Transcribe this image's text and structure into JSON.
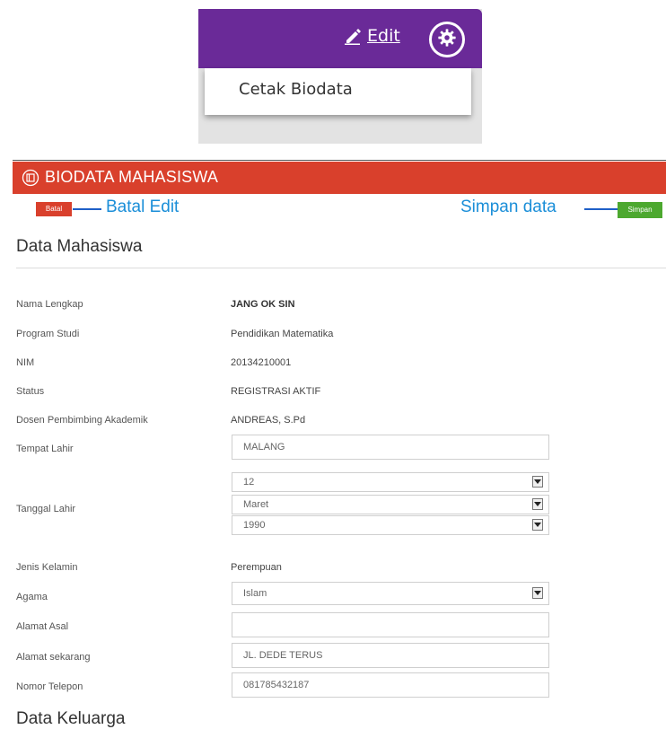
{
  "topbar": {
    "edit_label": "Edit",
    "dropdown_item": "Cetak Biodata"
  },
  "panel": {
    "title": "BIODATA MAHASISWA"
  },
  "actions": {
    "batal_label": "Batal",
    "simpan_label": "Simpan",
    "batal_callout": "Batal Edit",
    "simpan_callout": "Simpan data"
  },
  "sections": {
    "mahasiswa": "Data Mahasiswa",
    "keluarga": "Data Keluarga"
  },
  "fields": {
    "nama": {
      "label": "Nama Lengkap",
      "value": "JANG OK SIN"
    },
    "prodi": {
      "label": "Program Studi",
      "value": "Pendidikan Matematika"
    },
    "nim": {
      "label": "NIM",
      "value": "20134210001"
    },
    "status": {
      "label": "Status",
      "value": "REGISTRASI AKTIF"
    },
    "dosen": {
      "label": "Dosen Pembimbing Akademik",
      "value": "ANDREAS, S.Pd"
    },
    "tempat_lahir": {
      "label": "Tempat Lahir",
      "value": "MALANG"
    },
    "tanggal_lahir": {
      "label": "Tanggal Lahir",
      "day": "12",
      "month": "Maret",
      "year": "1990"
    },
    "jenis_kelamin": {
      "label": "Jenis Kelamin",
      "value": "Perempuan"
    },
    "agama": {
      "label": "Agama",
      "value": "Islam"
    },
    "alamat_asal": {
      "label": "Alamat Asal",
      "value": ""
    },
    "alamat_sekarang": {
      "label": "Alamat sekarang",
      "value": "JL. DEDE TERUS"
    },
    "telepon": {
      "label": "Nomor Telepon",
      "value": "081785432187"
    }
  },
  "colors": {
    "purple_bar": "#6a2a98",
    "header_red": "#d9402c",
    "simpan_green": "#4ca82f",
    "callout_blue": "#1a8ed8"
  },
  "icons": {
    "edit": "pencil-icon",
    "settings": "gear-icon",
    "panel": "id-card-icon",
    "select": "chevron-down-icon"
  }
}
